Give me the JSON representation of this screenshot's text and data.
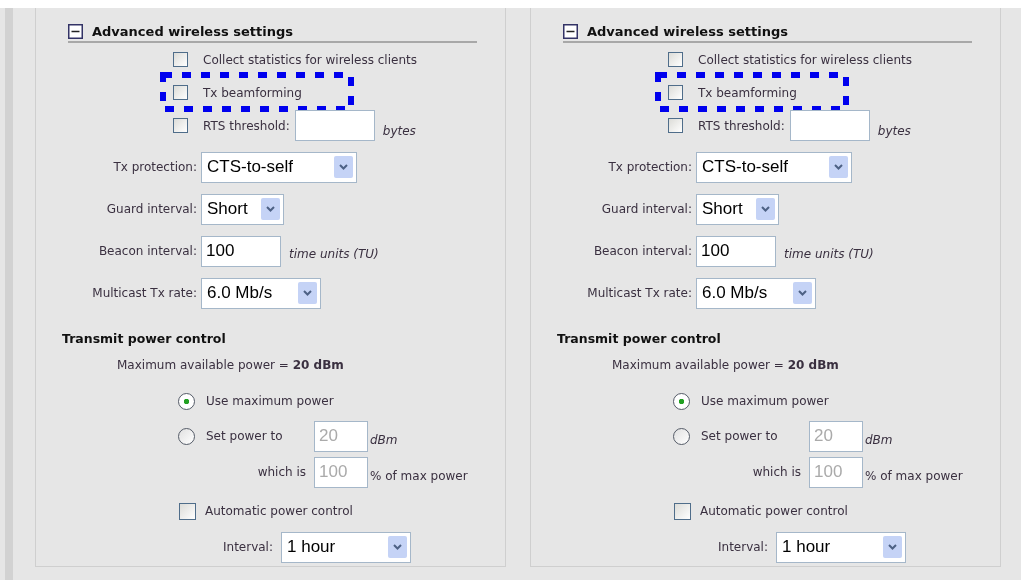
{
  "panels": [
    {
      "section": {
        "title": "Advanced wireless settings",
        "expanded": true
      },
      "checkboxes": [
        {
          "kind": "plain",
          "label": "Collect statistics for wireless clients",
          "checked": false,
          "highlighted": false
        },
        {
          "kind": "plain",
          "label": "Tx beamforming",
          "checked": false,
          "highlighted": true
        },
        {
          "kind": "input",
          "label": "RTS threshold:",
          "checked": false,
          "highlighted": false,
          "unit": "bytes"
        }
      ],
      "fields": [
        {
          "kind": "select",
          "label": "Tx protection:",
          "value": "CTS-to-self"
        },
        {
          "kind": "select",
          "label": "Guard interval:",
          "value": "Short"
        },
        {
          "kind": "input",
          "label": "Beacon interval:",
          "value": "100",
          "unit": "time units (TU)"
        },
        {
          "kind": "select",
          "label": "Multicast Tx rate:",
          "value": "6.0 Mb/s"
        }
      ],
      "power": {
        "title": "Transmit power control",
        "max_text": "Maximum available power = **20 dBm**",
        "options": [
          {
            "label": "Use maximum power",
            "selected": true
          },
          {
            "label": "Set power to",
            "selected": false,
            "value": "20",
            "unit": "dBm",
            "disabled": true
          }
        ],
        "which_is": {
          "label": "which is",
          "value": "100",
          "unit": "% of max power",
          "disabled": true
        },
        "auto": {
          "label": "Automatic power control",
          "checked": false
        },
        "interval": {
          "label": "Interval:",
          "value": "1 hour"
        }
      }
    },
    {
      "section": {
        "title": "Advanced wireless settings",
        "expanded": true
      },
      "checkboxes": [
        {
          "kind": "plain",
          "label": "Collect statistics for wireless clients",
          "checked": false,
          "highlighted": false
        },
        {
          "kind": "plain",
          "label": "Tx beamforming",
          "checked": false,
          "highlighted": true
        },
        {
          "kind": "input",
          "label": "RTS threshold:",
          "checked": false,
          "highlighted": false,
          "unit": "bytes"
        }
      ],
      "fields": [
        {
          "kind": "select",
          "label": "Tx protection:",
          "value": "CTS-to-self"
        },
        {
          "kind": "select",
          "label": "Guard interval:",
          "value": "Short"
        },
        {
          "kind": "input",
          "label": "Beacon interval:",
          "value": "100",
          "unit": "time units (TU)"
        },
        {
          "kind": "select",
          "label": "Multicast Tx rate:",
          "value": "6.0 Mb/s"
        }
      ],
      "power": {
        "title": "Transmit power control",
        "max_text": "Maximum available power = **20 dBm**",
        "options": [
          {
            "label": "Use maximum power",
            "selected": true
          },
          {
            "label": "Set power to",
            "selected": false,
            "value": "20",
            "unit": "dBm",
            "disabled": true
          }
        ],
        "which_is": {
          "label": "which is",
          "value": "100",
          "unit": "% of max power",
          "disabled": true
        },
        "auto": {
          "label": "Automatic power control",
          "checked": false
        },
        "interval": {
          "label": "Interval:",
          "value": "1 hour"
        }
      }
    }
  ]
}
